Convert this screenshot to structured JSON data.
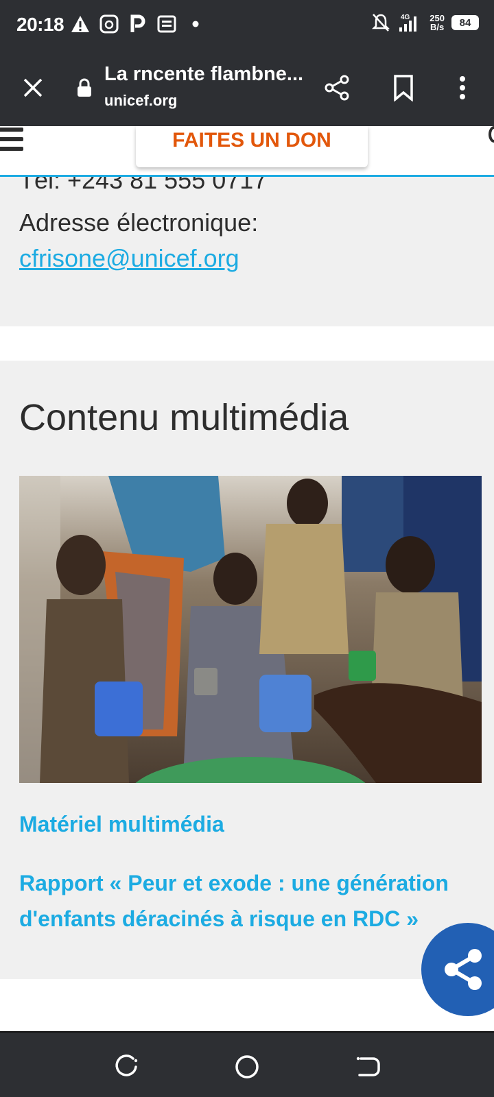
{
  "status_bar": {
    "time": "20:18",
    "left_icons": [
      "alert-triangle-icon",
      "photo-app-icon",
      "parking-app-icon",
      "news-icon",
      "dot-icon"
    ],
    "network": "4G",
    "speed_value": "250",
    "speed_unit": "B/s",
    "battery": "84"
  },
  "browser": {
    "page_title": "La rncente flambne...",
    "url": "unicef.org"
  },
  "header": {
    "donate_label": "FAITES UN DON"
  },
  "contact": {
    "tel_partial": "Tél: +243 81 555 0717",
    "email_label": "Adresse électronique:",
    "email": "cfrisone@unicef.org"
  },
  "multimedia": {
    "title": "Contenu multimédia",
    "link1": "Matériel multimédia",
    "link2": "Rapport « Peur et exode : une génération d'enfants déracinés à risque en RDC »"
  },
  "colors": {
    "unicef_blue": "#1cabe2",
    "donate_orange": "#e2570b",
    "share_fab": "#2260b4",
    "system_bar": "#2d2f33"
  }
}
